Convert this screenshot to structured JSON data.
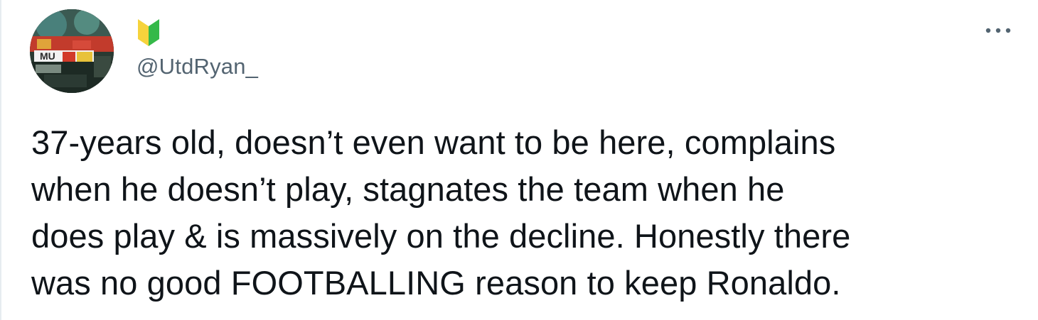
{
  "tweet": {
    "author": {
      "handle": "@UtdRyan_",
      "badge_icon": "beginner-badge-icon",
      "avatar_icon": "avatar-image"
    },
    "menu_icon": "more-options-icon",
    "text": "37-years old, doesn’t even want to be here, complains\nwhen he doesn’t play, stagnates the team when he\ndoes play & is massively on the decline. Honestly there\nwas no good FOOTBALLING reason to keep Ronaldo."
  },
  "colors": {
    "text": "#0f1419",
    "secondary": "#536471",
    "badge_green": "#35b949",
    "badge_yellow": "#f6d33c"
  }
}
